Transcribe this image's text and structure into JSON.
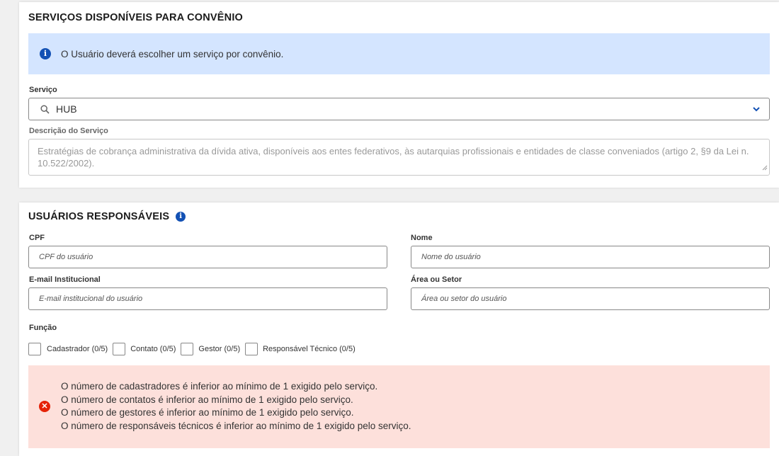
{
  "services_section": {
    "title": "SERVIÇOS DISPONÍVEIS PARA CONVÊNIO",
    "info_message": "O Usuário deverá escolher um serviço por convênio.",
    "service_label": "Serviço",
    "service_value": "HUB",
    "description_label": "Descrição do Serviço",
    "description_text": "Estratégias de cobrança administrativa da dívida ativa, disponíveis aos entes federativos, às autarquias profissionais e entidades de classe conveniados (artigo 2, §9 da Lei n. 10.522/2002)."
  },
  "users_section": {
    "title": "USUÁRIOS RESPONSÁVEIS",
    "cpf_label": "CPF",
    "cpf_placeholder": "CPF do usuário",
    "name_label": "Nome",
    "name_placeholder": "Nome do usuário",
    "email_label": "E-mail Institucional",
    "email_placeholder": "E-mail institucional do usuário",
    "area_label": "Área ou Setor",
    "area_placeholder": "Área ou setor do usuário",
    "role_label": "Função",
    "roles": [
      {
        "label": "Cadastrador (0/5)"
      },
      {
        "label": "Contato (0/5)"
      },
      {
        "label": "Gestor (0/5)"
      },
      {
        "label": "Responsável Técnico (0/5)"
      }
    ],
    "errors": [
      "O número de cadastradores é inferior ao mínimo de 1 exigido pelo serviço.",
      "O número de contatos é inferior ao mínimo de 1 exigido pelo serviço.",
      "O número de gestores é inferior ao mínimo de 1 exigido pelo serviço.",
      "O número de responsáveis técnicos é inferior ao mínimo de 1 exigido pelo serviço."
    ]
  },
  "colors": {
    "info_bg": "#d4e5ff",
    "info_icon": "#1351b4",
    "error_bg": "#fde0db",
    "error_icon": "#e52207"
  }
}
